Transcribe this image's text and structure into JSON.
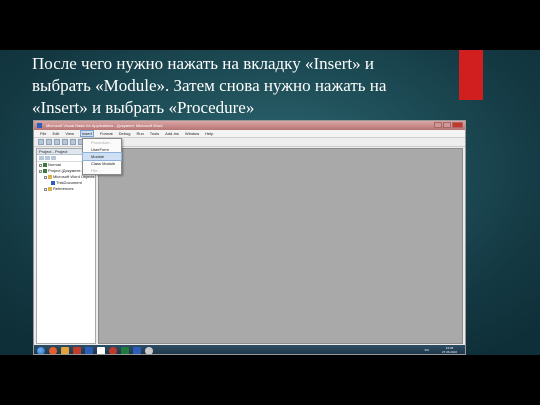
{
  "slide": {
    "title": "После чего нужно нажать на вкладку «Insert» и выбрать «Module». Затем снова нужно нажать на «Insert» и выбрать «Procedure»"
  },
  "vbe": {
    "window_title": "Microsoft Visual Basic for Applications - Документ Microsoft Word",
    "menu": [
      "File",
      "Edit",
      "View",
      "Insert",
      "Format",
      "Debug",
      "Run",
      "Tools",
      "Add-Ins",
      "Window",
      "Help"
    ],
    "active_menu": "Insert",
    "insert_menu": [
      "Procedure...",
      "UserForm",
      "Module",
      "Class Module",
      "File..."
    ],
    "highlighted_item": "Module",
    "project_pane_title": "Project - Project",
    "tree": [
      "Normal",
      "Project (Документ...)",
      "Microsoft Word Objects",
      "ThisDocument",
      "References"
    ]
  },
  "taskbar": {
    "language": "RU",
    "time": "13:45",
    "date": "27.06.2016"
  }
}
